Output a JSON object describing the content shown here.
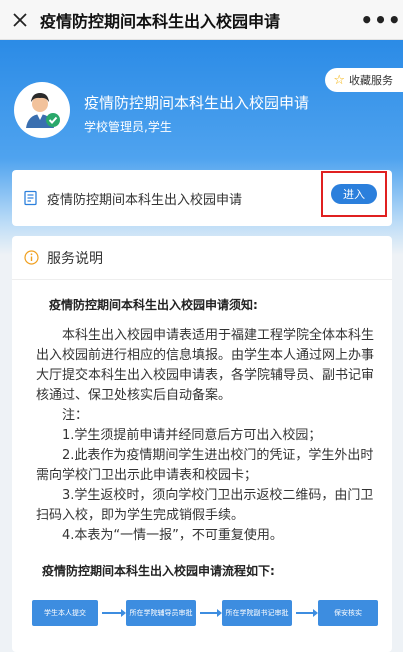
{
  "header": {
    "title": "疫情防控期间本科生出入校园申请",
    "more_label": "•••"
  },
  "banner": {
    "favorite_label": "收藏服务",
    "service_title": "疫情防控期间本科生出入校园申请",
    "audience": "学校管理员,学生"
  },
  "entry": {
    "label": "疫情防控期间本科生出入校园申请",
    "enter_label": "进入"
  },
  "description": {
    "heading": "服务说明",
    "notice_title": "疫情防控期间本科生出入校园申请须知:",
    "intro": "本科生出入校园申请表适用于福建工程学院全体本科生出入校园前进行相应的信息填报。由学生本人通过网上办事大厅提交本科生出入校园申请表，各学院辅导员、副书记审核通过、保卫处核实后自动备案。",
    "note_label": "注：",
    "notes": [
      "1.学生须提前申请并经同意后方可出入校园；",
      "2.此表作为疫情期间学生进出校门的凭证，学生外出时需向学校门卫出示此申请表和校园卡；",
      "3.学生返校时，须向学校门卫出示返校二维码，由门卫扫码入校，即为学生完成销假手续。",
      "4.本表为“一情一报”，不可重复使用。"
    ],
    "flow_title": "疫情防控期间本科生出入校园申请流程如下:",
    "flow_steps": [
      "学生本人提交",
      "所在学院辅导员审批",
      "所在学院副书记审批",
      "保安核实"
    ]
  },
  "colors": {
    "brand_blue": "#2b8be6",
    "button_blue": "#2b7fdc",
    "highlight_red": "#e02020"
  }
}
